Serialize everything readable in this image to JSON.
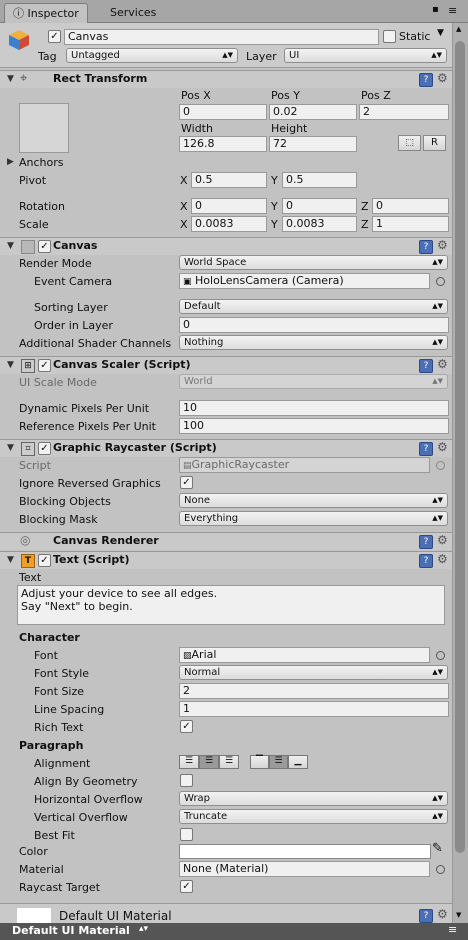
{
  "tabs": {
    "inspector": "Inspector",
    "services": "Services"
  },
  "object": {
    "name": "Canvas",
    "static_label": "Static",
    "tag_label": "Tag",
    "tag_value": "Untagged",
    "layer_label": "Layer",
    "layer_value": "UI"
  },
  "rect_transform": {
    "title": "Rect Transform",
    "pos_x_label": "Pos X",
    "pos_y_label": "Pos Y",
    "pos_z_label": "Pos Z",
    "pos_x": "0",
    "pos_y": "0.02",
    "pos_z": "2",
    "width_label": "Width",
    "height_label": "Height",
    "width": "126.8",
    "height": "72",
    "r_label": "R",
    "anchors_label": "Anchors",
    "pivot_label": "Pivot",
    "pivot_x": "0.5",
    "pivot_y": "0.5",
    "rotation_label": "Rotation",
    "rot_x": "0",
    "rot_y": "0",
    "rot_z": "0",
    "scale_label": "Scale",
    "scale_x": "0.0083",
    "scale_y": "0.0083",
    "scale_z": "1",
    "x": "X",
    "y": "Y",
    "z": "Z"
  },
  "canvas": {
    "title": "Canvas",
    "render_mode_label": "Render Mode",
    "render_mode": "World Space",
    "event_camera_label": "Event Camera",
    "event_camera": "HoloLensCamera (Camera)",
    "sorting_layer_label": "Sorting Layer",
    "sorting_layer": "Default",
    "order_label": "Order in Layer",
    "order": "0",
    "shader_channels_label": "Additional Shader Channels",
    "shader_channels": "Nothing"
  },
  "canvas_scaler": {
    "title": "Canvas Scaler (Script)",
    "ui_scale_label": "UI Scale Mode",
    "ui_scale": "World",
    "dynamic_label": "Dynamic Pixels Per Unit",
    "dynamic": "10",
    "reference_label": "Reference Pixels Per Unit",
    "reference": "100"
  },
  "raycaster": {
    "title": "Graphic Raycaster (Script)",
    "script_label": "Script",
    "script": "GraphicRaycaster",
    "ignore_label": "Ignore Reversed Graphics",
    "blocking_objects_label": "Blocking Objects",
    "blocking_objects": "None",
    "blocking_mask_label": "Blocking Mask",
    "blocking_mask": "Everything"
  },
  "canvas_renderer": {
    "title": "Canvas Renderer"
  },
  "text": {
    "title": "Text (Script)",
    "text_label": "Text",
    "text_line1": "Adjust your device to see all edges.",
    "text_line2": "Say \"Next\" to begin.",
    "character_label": "Character",
    "font_label": "Font",
    "font": "Arial",
    "font_style_label": "Font Style",
    "font_style": "Normal",
    "font_size_label": "Font Size",
    "font_size": "2",
    "line_spacing_label": "Line Spacing",
    "line_spacing": "1",
    "rich_text_label": "Rich Text",
    "paragraph_label": "Paragraph",
    "alignment_label": "Alignment",
    "align_geometry_label": "Align By Geometry",
    "h_overflow_label": "Horizontal Overflow",
    "h_overflow": "Wrap",
    "v_overflow_label": "Vertical Overflow",
    "v_overflow": "Truncate",
    "best_fit_label": "Best Fit",
    "color_label": "Color",
    "material_label": "Material",
    "material": "None (Material)",
    "raycast_label": "Raycast Target"
  },
  "material_preview": {
    "title": "Default UI Material"
  },
  "bottom": {
    "label": "Default UI Material"
  },
  "icons": {
    "check": "✓",
    "dropdown": "▾",
    "help": "?",
    "gear": "⚙",
    "lock": "🔒",
    "menu": "≡"
  }
}
